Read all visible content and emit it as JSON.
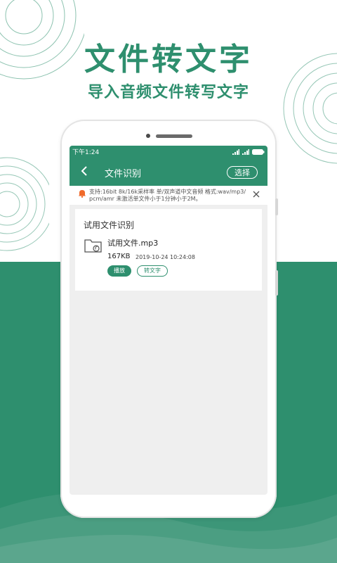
{
  "promo": {
    "headline": "文件转文字",
    "subheadline": "导入音频文件转写文字"
  },
  "colors": {
    "brand_green": "#2e8f6e",
    "notice_icon_orange": "#f06a2b"
  },
  "status_bar": {
    "time": "下午1:24",
    "icons": [
      "signal-icon",
      "signal-icon",
      "battery-icon"
    ]
  },
  "app_bar": {
    "back_icon": "chevron-left-icon",
    "title": "文件识别",
    "select_label": "选择"
  },
  "notice": {
    "icon": "bell-icon",
    "text": "支持:16bit 8k/16k采样率 单/双声道中文音频 格式:wav/mp3/pcm/amr 未激活单文件小于1分钟小于2M。",
    "close_icon": "close-icon"
  },
  "trial_card": {
    "title": "试用文件识别",
    "file_icon": "audio-folder-icon",
    "file_name": "试用文件.mp3",
    "file_size": "167KB",
    "file_date": "2019-10-24  10:24:08",
    "play_label": "播放",
    "convert_label": "转文字"
  }
}
